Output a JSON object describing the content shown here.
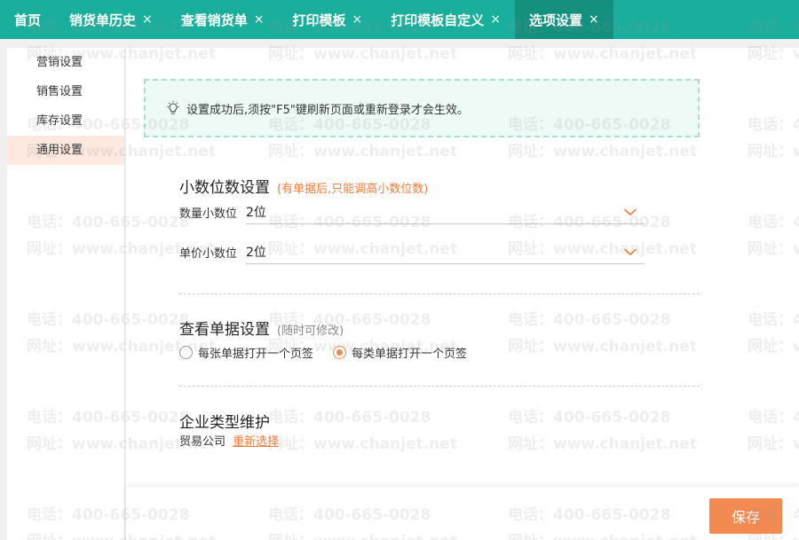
{
  "tabs": [
    {
      "label": "首页",
      "closable": false,
      "active": false
    },
    {
      "label": "销货单历史",
      "closable": true,
      "active": false
    },
    {
      "label": "查看销货单",
      "closable": true,
      "active": false
    },
    {
      "label": "打印模板",
      "closable": true,
      "active": false
    },
    {
      "label": "打印模板自定义",
      "closable": true,
      "active": false
    },
    {
      "label": "选项设置",
      "closable": true,
      "active": true
    }
  ],
  "close_glyph": "×",
  "sidebar": {
    "items": [
      {
        "label": "营销设置",
        "active": false
      },
      {
        "label": "销售设置",
        "active": false
      },
      {
        "label": "库存设置",
        "active": false
      },
      {
        "label": "通用设置",
        "active": true
      }
    ]
  },
  "notice": {
    "text": "设置成功后,须按\"F5\"键刷新页面或重新登录才会生效。",
    "icon": "lightbulb-icon"
  },
  "decimal": {
    "title": "小数位数设置",
    "hint": "(有单据后,只能调高小数位数)",
    "quantity": {
      "label": "数量小数位",
      "value": "2位"
    },
    "price": {
      "label": "单价小数位",
      "value": "2位"
    }
  },
  "view": {
    "title": "查看单据设置",
    "hint": "(随时可修改)",
    "options": [
      {
        "label": "每张单据打开一个页签",
        "checked": false
      },
      {
        "label": "每类单据打开一个页签",
        "checked": true
      }
    ]
  },
  "company": {
    "title": "企业类型维护",
    "type": "贸易公司",
    "reselect": "重新选择"
  },
  "footer": {
    "save_label": "保存"
  },
  "watermark": {
    "phone": "电话：400-665-0028",
    "site": "网址：www.chanjet.net"
  },
  "colors": {
    "tabbar": "#1aaf9c",
    "tab_active": "#14907f",
    "accent": "#f28a52",
    "hint_orange": "#ef7d3c",
    "sidebar_active": "#fde9df",
    "notice_bg": "#eefaf5",
    "notice_border": "#a9e2cb"
  }
}
